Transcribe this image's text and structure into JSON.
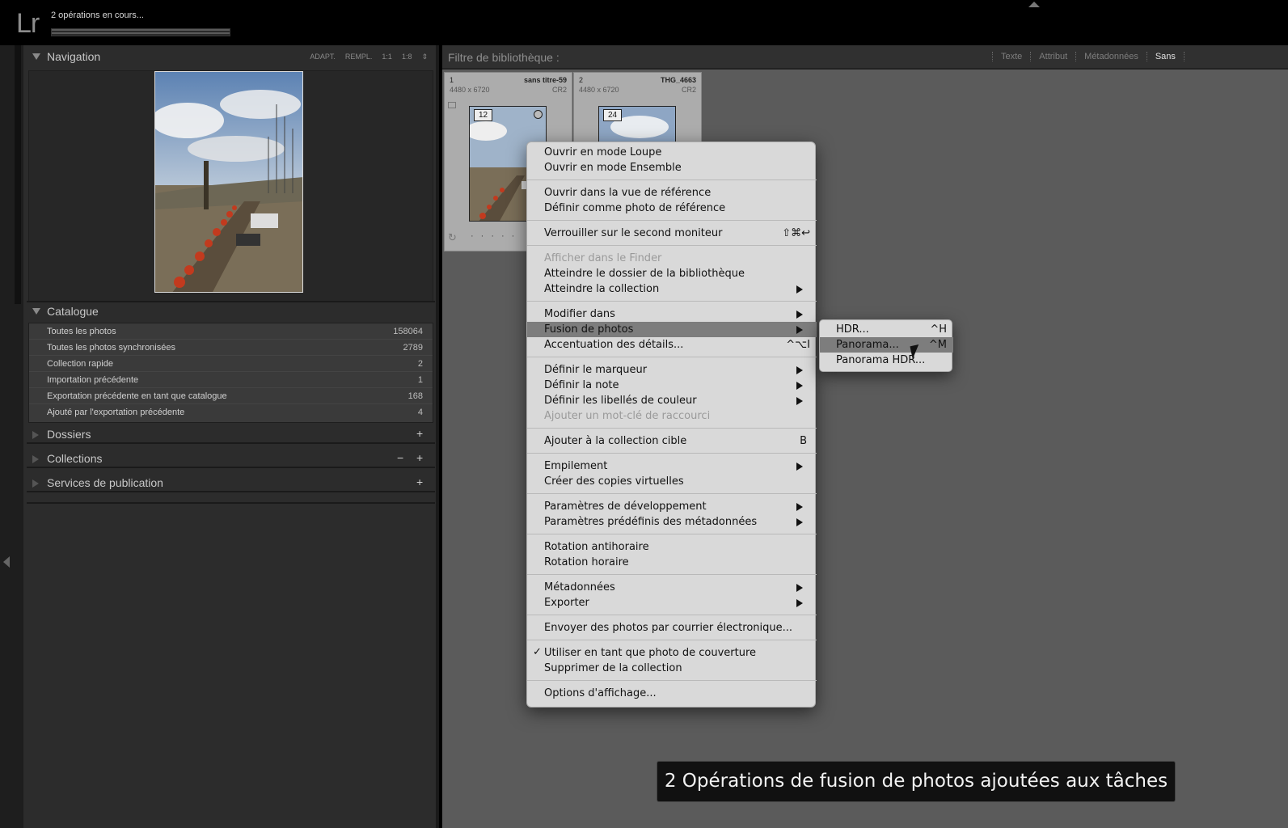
{
  "app": {
    "logo": "Lr",
    "operations_text": "2 opérations en cours..."
  },
  "left_panel": {
    "navigation": {
      "title": "Navigation",
      "zoom_options": [
        "ADAPT.",
        "REMPL.",
        "1:1",
        "1:8"
      ]
    },
    "catalogue": {
      "title": "Catalogue",
      "items": [
        {
          "label": "Toutes les photos",
          "count": "158064"
        },
        {
          "label": "Toutes les photos synchronisées",
          "count": "2789"
        },
        {
          "label": "Collection rapide",
          "count": "2"
        },
        {
          "label": "Importation précédente",
          "count": "1"
        },
        {
          "label": "Exportation précédente en tant que catalogue",
          "count": "168"
        },
        {
          "label": "Ajouté par l'exportation précédente",
          "count": "4"
        }
      ]
    },
    "dossiers": {
      "title": "Dossiers",
      "add": "+"
    },
    "collections": {
      "title": "Collections",
      "remove": "−",
      "add": "+"
    },
    "publish": {
      "title": "Services de publication",
      "add": "+"
    }
  },
  "filter_bar": {
    "title": "Filtre de bibliothèque :",
    "tabs": [
      "Texte",
      "Attribut",
      "Métadonnées",
      "Sans"
    ],
    "active": "Sans"
  },
  "grid": {
    "cells": [
      {
        "index": "1",
        "name": "sans titre-59",
        "dims": "4480 x 6720",
        "ext": "CR2",
        "badge": "12"
      },
      {
        "index": "2",
        "name": "THG_4663",
        "dims": "4480 x 6720",
        "ext": "CR2",
        "badge": "24"
      }
    ]
  },
  "context_menu": {
    "items": [
      {
        "label": "Ouvrir en mode Loupe"
      },
      {
        "label": "Ouvrir en mode Ensemble"
      },
      {
        "label": "Ouvrir dans la vue de référence"
      },
      {
        "label": "Définir comme photo de référence"
      },
      {
        "label": "Verrouiller sur le second moniteur",
        "shortcut": "⇧⌘↩"
      },
      {
        "label": "Afficher dans le Finder"
      },
      {
        "label": "Atteindre le dossier de la bibliothèque"
      },
      {
        "label": "Atteindre la collection"
      },
      {
        "label": "Modifier dans"
      },
      {
        "label": "Fusion de photos"
      },
      {
        "label": "Accentuation des détails...",
        "shortcut": "^⌥I"
      },
      {
        "label": "Définir le marqueur"
      },
      {
        "label": "Définir la note"
      },
      {
        "label": "Définir les libellés de couleur"
      },
      {
        "label": "Ajouter un mot-clé de raccourci"
      },
      {
        "label": "Ajouter à la collection cible",
        "shortcut": "B"
      },
      {
        "label": "Empilement"
      },
      {
        "label": "Créer des copies virtuelles"
      },
      {
        "label": "Paramètres de développement"
      },
      {
        "label": "Paramètres prédéfinis des métadonnées"
      },
      {
        "label": "Rotation antihoraire"
      },
      {
        "label": "Rotation horaire"
      },
      {
        "label": "Métadonnées"
      },
      {
        "label": "Exporter"
      },
      {
        "label": "Envoyer des photos par courrier électronique..."
      },
      {
        "label": "Utiliser en tant que photo de couverture",
        "check": "✓"
      },
      {
        "label": "Supprimer de la collection"
      },
      {
        "label": "Options d'affichage..."
      }
    ]
  },
  "submenu": {
    "items": [
      {
        "label": "HDR...",
        "shortcut": "^H"
      },
      {
        "label": "Panorama...",
        "shortcut": "^M"
      },
      {
        "label": "Panorama HDR..."
      }
    ]
  },
  "toast": {
    "text": "2 Opérations de fusion de photos ajoutées aux tâches"
  }
}
